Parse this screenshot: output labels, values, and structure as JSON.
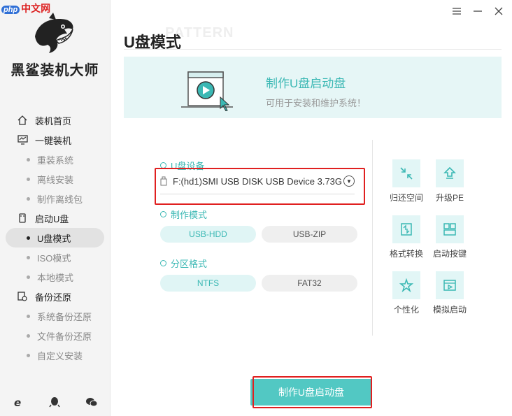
{
  "watermark": {
    "php": "php",
    "site": "中文网"
  },
  "brand": {
    "name": "黑鲨装机大师"
  },
  "window": {
    "menu_icon": "menu-icon",
    "min_icon": "minimize-icon",
    "close_icon": "close-icon"
  },
  "sidebar": {
    "items": [
      {
        "label": "装机首页",
        "type": "top",
        "icon": "home-icon"
      },
      {
        "label": "一键装机",
        "type": "top",
        "icon": "monitor-icon"
      },
      {
        "label": "重装系统",
        "type": "sub"
      },
      {
        "label": "离线安装",
        "type": "sub"
      },
      {
        "label": "制作离线包",
        "type": "sub"
      },
      {
        "label": "启动U盘",
        "type": "top",
        "icon": "usb-icon"
      },
      {
        "label": "U盘模式",
        "type": "sub",
        "active": true
      },
      {
        "label": "ISO模式",
        "type": "sub"
      },
      {
        "label": "本地模式",
        "type": "sub"
      },
      {
        "label": "备份还原",
        "type": "top",
        "icon": "backup-icon"
      },
      {
        "label": "系统备份还原",
        "type": "sub"
      },
      {
        "label": "文件备份还原",
        "type": "sub"
      },
      {
        "label": "自定义安装",
        "type": "sub"
      }
    ],
    "footer_icons": [
      "ie-icon",
      "qq-icon",
      "wechat-icon"
    ]
  },
  "page": {
    "title": "U盘模式",
    "title_bg": "PATTERN"
  },
  "banner": {
    "title": "制作U盘启动盘",
    "subtitle": "可用于安装和维护系统！"
  },
  "device": {
    "label": "U盘设备",
    "value": "F:(hd1)SMI USB DISK USB Device 3.73GB"
  },
  "mode": {
    "label": "制作模式",
    "options": [
      "USB-HDD",
      "USB-ZIP"
    ],
    "selected": "USB-HDD"
  },
  "partition": {
    "label": "分区格式",
    "options": [
      "NTFS",
      "FAT32"
    ],
    "selected": "NTFS"
  },
  "tools": [
    {
      "label": "归还空间",
      "icon": "restore-space-icon"
    },
    {
      "label": "升级PE",
      "icon": "upgrade-icon"
    },
    {
      "label": "格式转换",
      "icon": "format-convert-icon"
    },
    {
      "label": "启动按键",
      "icon": "boot-key-icon"
    },
    {
      "label": "个性化",
      "icon": "personalize-icon"
    },
    {
      "label": "模拟启动",
      "icon": "simulate-boot-icon"
    }
  ],
  "action": {
    "make_label": "制作U盘启动盘"
  },
  "colors": {
    "accent": "#3bb8b4",
    "button": "#52c8c3",
    "highlight": "#e02020"
  }
}
